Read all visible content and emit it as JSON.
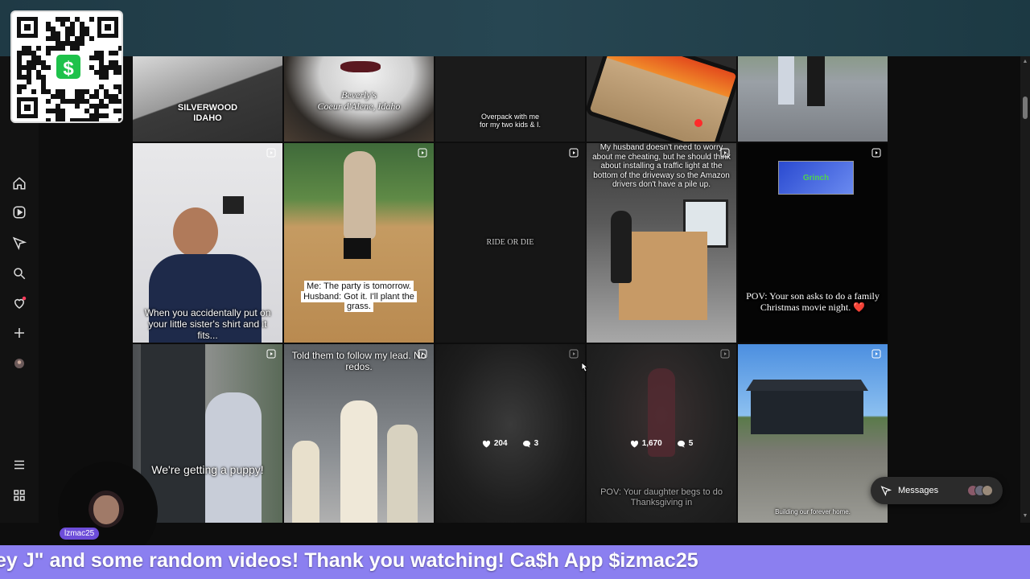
{
  "overlay": {
    "cashapp_qr_icon": "cashapp-qr",
    "cashapp_symbol": "$",
    "webcam_username": "lzmac25",
    "ticker_text": "ey J\" and some random videos! Thank you watching! Ca$h App $izmac25"
  },
  "sidebar": {
    "icons": [
      "home-icon",
      "video-icon",
      "explore-icon",
      "search-icon",
      "notifications-icon",
      "create-icon",
      "profile-avatar",
      "menu-icon",
      "apps-icon"
    ]
  },
  "grid": {
    "row1": [
      {
        "caption_l1": "SILVERWOOD",
        "caption_l2": "IDAHO"
      },
      {
        "caption_l1": "Beverly's",
        "caption_l2": "Coeur d'Alene, Idaho"
      },
      {
        "caption_l1": "Overpack with me",
        "caption_l2": "for my two kids & I."
      },
      {
        "caption": ""
      },
      {
        "caption": ""
      }
    ],
    "row2": [
      {
        "caption": "When you accidentally put on your little sister's shirt and it fits..."
      },
      {
        "caption": "Me: The party is tomorrow. Husband: Got it. I'll plant the grass."
      },
      {
        "caption": "RIDE OR DIE"
      },
      {
        "caption": "My husband doesn't need to worry about me cheating, but he should think about installing a traffic light at the bottom of the driveway so the Amazon drivers don't have a pile up."
      },
      {
        "caption": "POV: Your son asks to do a family Christmas movie night. ❤️",
        "badge": "Grinch"
      }
    ],
    "row3": [
      {
        "caption": "We're getting a puppy!"
      },
      {
        "caption": "Told them to follow my lead. No redos."
      },
      {
        "likes": "204",
        "comments": "3"
      },
      {
        "likes": "1,670",
        "comments": "5",
        "caption": "POV: Your daughter begs to do Thanksgiving in"
      },
      {
        "caption": "Building our forever home."
      }
    ]
  },
  "messages": {
    "label": "Messages"
  },
  "colors": {
    "top_bar": "#274652",
    "ticker": "#8b7ff0",
    "cashapp_green": "#1ec24b",
    "notification_dot": "#ff3b5c"
  }
}
